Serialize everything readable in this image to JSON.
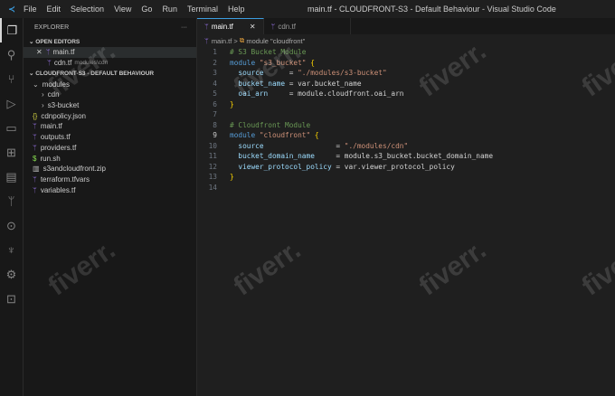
{
  "titlebar": {
    "menu": [
      "File",
      "Edit",
      "Selection",
      "View",
      "Go",
      "Run",
      "Terminal",
      "Help"
    ],
    "title": "main.tf - CLOUDFRONT-S3 - Default Behaviour - Visual Studio Code"
  },
  "activity": [
    "explorer-icon",
    "search-icon",
    "source-control-icon",
    "run-debug-icon",
    "remote-explorer-icon",
    "extensions-icon",
    "folder-icon",
    "terraform-icon",
    "git-graph-icon",
    "python-icon",
    "settings-sync-icon",
    "terminal-icon"
  ],
  "sidebar": {
    "title": "EXPLORER",
    "more": "···",
    "open_editors": "OPEN EDITORS",
    "open": [
      {
        "name": "main.tf",
        "hint": ""
      },
      {
        "name": "cdn.tf",
        "hint": "modules\\cdn"
      }
    ],
    "project": "CLOUDFRONT-S3 - DEFAULT BEHAVIOUR",
    "tree": [
      {
        "name": "modules",
        "icon": "⌄",
        "indent": 1
      },
      {
        "name": "cdn",
        "icon": "›",
        "indent": 2
      },
      {
        "name": "s3-bucket",
        "icon": "›",
        "indent": 2
      },
      {
        "name": "cdnpolicy.json",
        "icon": "{}",
        "indent": 1
      },
      {
        "name": "main.tf",
        "icon": "tf",
        "indent": 1
      },
      {
        "name": "outputs.tf",
        "icon": "tf",
        "indent": 1
      },
      {
        "name": "providers.tf",
        "icon": "tf",
        "indent": 1
      },
      {
        "name": "run.sh",
        "icon": "$",
        "indent": 1
      },
      {
        "name": "s3andcloudfront.zip",
        "icon": "zip",
        "indent": 1
      },
      {
        "name": "terraform.tfvars",
        "icon": "tf",
        "indent": 1
      },
      {
        "name": "variables.tf",
        "icon": "tf",
        "indent": 1
      }
    ]
  },
  "tabs": [
    {
      "label": "main.tf",
      "close": "✕"
    },
    {
      "label": "cdn.tf"
    }
  ],
  "breadcrumb": {
    "file": "main.tf",
    "sep": ">",
    "symbol": "module \"cloudfront\""
  },
  "code": [
    [
      [
        "c",
        "# S3 Bucket Module"
      ]
    ],
    [
      [
        "k",
        "module "
      ],
      [
        "s",
        "\"s3_bucket\" "
      ],
      [
        "b",
        "{"
      ]
    ],
    [
      [
        "v",
        "  source      "
      ],
      [
        "t",
        "= "
      ],
      [
        "s",
        "\"./modules/s3-bucket\""
      ]
    ],
    [
      [
        "v",
        "  bucket_name "
      ],
      [
        "t",
        "= var.bucket_name"
      ]
    ],
    [
      [
        "v",
        "  oai_arn     "
      ],
      [
        "t",
        "= module.cloudfront.oai_arn"
      ]
    ],
    [
      [
        "b",
        "}"
      ]
    ],
    [],
    [
      [
        "c",
        "# Cloudfront Module"
      ]
    ],
    [
      [
        "k",
        "module "
      ],
      [
        "s",
        "\"cloudfront\" "
      ],
      [
        "b",
        "{"
      ]
    ],
    [
      [
        "v",
        "  source                 "
      ],
      [
        "t",
        "= "
      ],
      [
        "s",
        "\"./modules/cdn\""
      ]
    ],
    [
      [
        "v",
        "  bucket_domain_name     "
      ],
      [
        "t",
        "= module.s3_bucket.bucket_domain_name"
      ]
    ],
    [
      [
        "v",
        "  viewer_protocol_policy "
      ],
      [
        "t",
        "= var.viewer_protocol_policy"
      ]
    ],
    [
      [
        "b",
        "}"
      ]
    ],
    []
  ],
  "current_line": 9,
  "watermark": "fiverr."
}
